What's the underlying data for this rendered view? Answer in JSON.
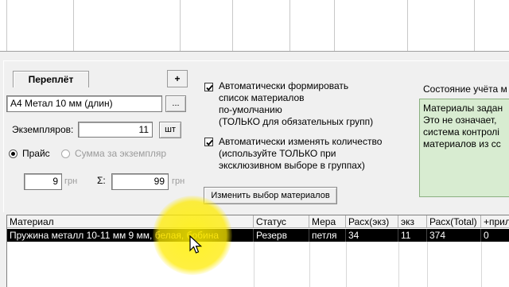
{
  "top_grid_columns": 7,
  "binding": {
    "tab_label": "Переплёт",
    "add_label": "+",
    "binding_value": "А4 Метал 10 мм (длин)",
    "browse_label": "...",
    "copies_label": "Экземпляров:",
    "copies_value": "11",
    "copies_unit": "шт",
    "price_radio_label": "Прайс",
    "price_radio_selected": true,
    "sum_radio_label": "Сумма за экземпляр",
    "sum_radio_selected": false,
    "price_value": "9",
    "price_unit": "грн",
    "sigma_label": "Σ:",
    "sigma_value": "99",
    "sigma_unit": "грн"
  },
  "options": {
    "auto_form_checked": true,
    "auto_form_lines": [
      "Автоматически формировать",
      "список материалов",
      "по-умолчанию",
      "(ТОЛЬКО для обязательных групп)"
    ],
    "auto_qty_checked": true,
    "auto_qty_lines": [
      "Автоматически изменять количество",
      "(используйте ТОЛЬКО при",
      "эксклюзивном выборе в группах)"
    ],
    "change_button": "Изменить выбор материалов"
  },
  "status": {
    "title": "Состояние учёта м",
    "lines": [
      "Материалы задан",
      "",
      "Это не означает,",
      "система контролі",
      "материалов из сс"
    ]
  },
  "table": {
    "headers": [
      "Материал",
      "Статус",
      "Мера",
      "Расх(экз)",
      "экз",
      "Расх(Total)",
      "+прил"
    ],
    "rows": [
      {
        "material_main": "Пружина металл 10-11 мм 9 мм, ",
        "material_color": "белая, бобина",
        "status": "Резерв",
        "unit": "петля",
        "per_copy": "34",
        "copies": "11",
        "total": "374",
        "extra": "0"
      }
    ]
  },
  "colors": {
    "status_bg": "#d8ecd1",
    "selected_row_bg": "#000000",
    "material_color_text": "#e8c24a",
    "cursor_highlight": "#ffeb00"
  }
}
